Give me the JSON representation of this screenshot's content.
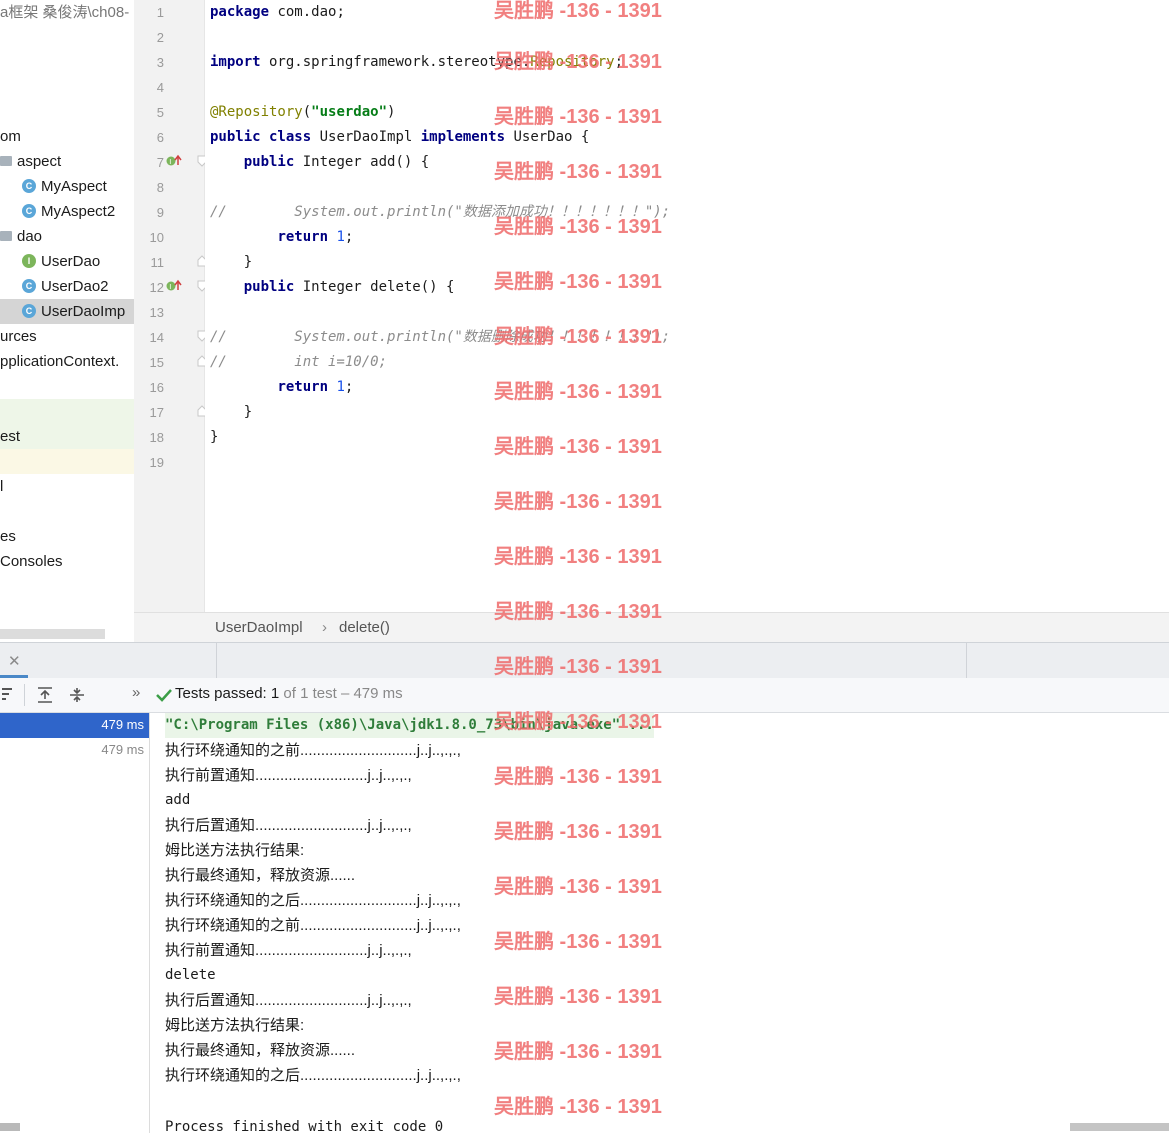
{
  "tree": {
    "header_text": "a框架 桑俊涛\\ch08-",
    "items": [
      {
        "label": "om",
        "kind": "pkg"
      },
      {
        "label": "aspect",
        "kind": "folder"
      },
      {
        "label": "MyAspect",
        "kind": "class"
      },
      {
        "label": "MyAspect2",
        "kind": "class"
      },
      {
        "label": "dao",
        "kind": "folder"
      },
      {
        "label": "UserDao",
        "kind": "interface"
      },
      {
        "label": "UserDao2",
        "kind": "class"
      },
      {
        "label": "UserDaoImp",
        "kind": "class"
      },
      {
        "label": "urces",
        "kind": "text"
      },
      {
        "label": "pplicationContext.",
        "kind": "text"
      },
      {
        "label": "est",
        "kind": "text"
      },
      {
        "label": "l",
        "kind": "text"
      },
      {
        "label": "es",
        "kind": "text"
      },
      {
        "label": "Consoles",
        "kind": "text"
      }
    ]
  },
  "editor": {
    "line_numbers": [
      "1",
      "2",
      "3",
      "4",
      "5",
      "6",
      "7",
      "8",
      "9",
      "10",
      "11",
      "12",
      "13",
      "14",
      "15",
      "16",
      "17",
      "18",
      "19"
    ],
    "lines": [
      {
        "kw": "package",
        "rest": " com.dao;"
      },
      {
        "text": ""
      },
      {
        "kw": "import",
        "rest": " org.springframework.stereotype.",
        "an": "Repository",
        "end": ";"
      },
      {
        "text": ""
      },
      {
        "an": "@Repository",
        "open": "(",
        "st": "\"userdao\"",
        "close": ")"
      },
      {
        "kw": "public class",
        "rest": " UserDaoImpl ",
        "kw2": "implements",
        "rest2": " UserDao {"
      },
      {
        "indent": "    ",
        "kw": "public",
        "rest": " Integer add() {"
      },
      {
        "text": ""
      },
      {
        "cm": "//        System.out.println(\"数据添加成功！！！！！！！\");"
      },
      {
        "indent": "        ",
        "kw": "return",
        "num": " 1",
        "end": ";"
      },
      {
        "text": "    }"
      },
      {
        "indent": "    ",
        "kw": "public",
        "rest": " Integer delete() {"
      },
      {
        "text": ""
      },
      {
        "cm": "//        System.out.println(\"数据删除成功！！！！！！！\");"
      },
      {
        "cm": "//        int i=10/0;"
      },
      {
        "indent": "        ",
        "kw": "return",
        "num": " 1",
        "end": ";"
      },
      {
        "text": "    }"
      },
      {
        "text": "}"
      },
      {
        "text": ""
      }
    ]
  },
  "breadcrumb": {
    "class_name": "UserDaoImpl",
    "separator": "›",
    "method": "delete()"
  },
  "run": {
    "tests_passed_label": "Tests passed:",
    "tests_passed_count": "1",
    "tests_passed_rest": "of 1 test – 479 ms",
    "tests": [
      {
        "time": "479 ms",
        "selected": true
      },
      {
        "time": "479 ms",
        "selected": false
      }
    ],
    "console_lines": [
      "\"C:\\Program Files (x86)\\Java\\jdk1.8.0_73\\bin\\java.exe\" ...",
      "执行环绕通知的之前............................j..j..,.,.,",
      "执行前置通知...........................j..j..,.,.,",
      "add",
      "执行后置通知...........................j..j..,.,.,",
      "姆比送方法执行结果:",
      "执行最终通知，释放资源......",
      "执行环绕通知的之后............................j..j..,.,.,",
      "执行环绕通知的之前............................j..j..,.,.,",
      "执行前置通知...........................j..j..,.,.,",
      "delete",
      "执行后置通知...........................j..j..,.,.,",
      "姆比送方法执行结果:",
      "执行最终通知，释放资源......",
      "执行环绕通知的之后............................j..j..,.,.,",
      "",
      "Process finished with exit code 0"
    ]
  },
  "watermark": "吴胜鹏 -136 - 1391"
}
